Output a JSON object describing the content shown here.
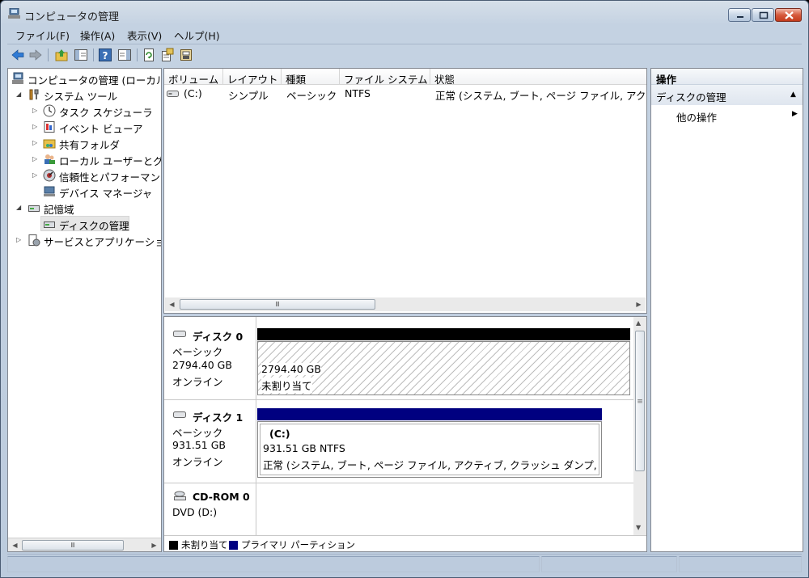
{
  "window": {
    "title": "コンピュータの管理"
  },
  "menu": [
    {
      "label": "ファイル(F)"
    },
    {
      "label": "操作(A)"
    },
    {
      "label": "表示(V)"
    },
    {
      "label": "ヘルプ(H)"
    }
  ],
  "tree": {
    "root": "コンピュータの管理 (ローカル)",
    "system_tools": "システム ツール",
    "task_scheduler": "タスク スケジューラ",
    "event_viewer": "イベント ビューア",
    "shared_folders": "共有フォルダ",
    "local_users": "ローカル ユーザーとグループ",
    "reliability": "信頼性とパフォーマンス",
    "device_manager": "デバイス マネージャ",
    "storage": "記憶域",
    "disk_management": "ディスクの管理",
    "services": "サービスとアプリケーション"
  },
  "volume_list": {
    "columns": [
      "ボリューム",
      "レイアウト",
      "種類",
      "ファイル システム",
      "状態"
    ],
    "rows": [
      {
        "volume": "(C:)",
        "layout": "シンプル",
        "type": "ベーシック",
        "fs": "NTFS",
        "status": "正常 (システム, ブート, ページ ファイル, アクティブ, クラッシュ ダンプ, プライマリ パーティション)"
      }
    ]
  },
  "disks": {
    "disk0": {
      "name": "ディスク 0",
      "type": "ベーシック",
      "size": "2794.40 GB",
      "state": "オンライン",
      "part_size": "2794.40 GB",
      "part_label": "未割り当て"
    },
    "disk1": {
      "name": "ディスク 1",
      "type": "ベーシック",
      "size": "931.51 GB",
      "state": "オンライン",
      "part_name": "(C:)",
      "part_size": "931.51 GB NTFS",
      "part_status": "正常 (システム, ブート, ページ ファイル, アクティブ, クラッシュ ダンプ, プライマリ パーティション)"
    },
    "cdrom0": {
      "name": "CD-ROM 0",
      "type": "DVD (D:)"
    }
  },
  "legend": {
    "unallocated": "未割り当て",
    "primary": "プライマリ パーティション",
    "unallocated_color": "#000000",
    "primary_color": "#000080"
  },
  "actions": {
    "title": "操作",
    "section": "ディスクの管理",
    "other": "他の操作"
  },
  "scroll": {
    "thumb_glyph": "Ⅲ",
    "vthumb_glyph": "≡"
  }
}
